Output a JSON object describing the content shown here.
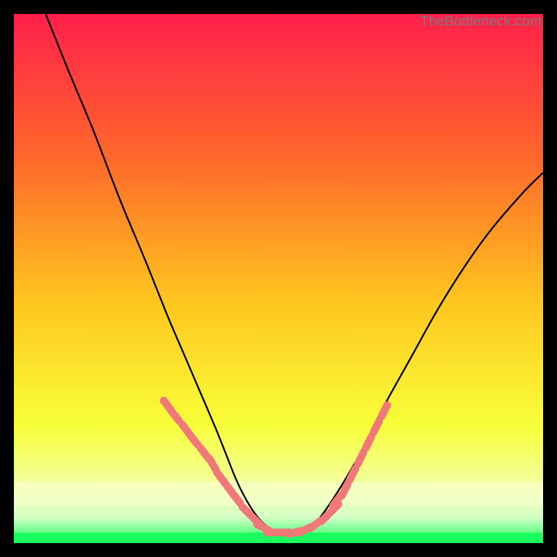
{
  "watermark": "TheBottleneck.com",
  "gradient": {
    "top": "#ff1f4b",
    "mid_upper": "#ff7a2a",
    "mid": "#ffd21f",
    "mid_lower": "#f6ff3a",
    "band": "#faffcf",
    "bottom": "#19ff5e"
  },
  "curve_color": "#000000",
  "marker_color": "#f07878",
  "chart_data": {
    "type": "line",
    "title": "",
    "xlabel": "",
    "ylabel": "",
    "xlim": [
      0,
      100
    ],
    "ylim": [
      0,
      100
    ],
    "series": [
      {
        "name": "curve",
        "x": [
          6,
          10,
          15,
          20,
          25,
          29,
          32,
          35,
          38,
          40,
          42,
          44,
          46,
          48,
          50,
          52,
          54,
          56,
          58,
          62,
          66,
          70,
          75,
          80,
          85,
          90,
          96,
          100
        ],
        "y": [
          100,
          90,
          78,
          65,
          53,
          43,
          36,
          29,
          22,
          17,
          12,
          8,
          5,
          3,
          2,
          2,
          2,
          3,
          5,
          11,
          18,
          26,
          35,
          44,
          52,
          59,
          66,
          70
        ]
      },
      {
        "name": "markers-left",
        "x": [
          29,
          30.5,
          32.5,
          34,
          36,
          37.5,
          39,
          40.5,
          42,
          44,
          46
        ],
        "y": [
          26,
          24,
          21.5,
          19.5,
          17,
          15,
          12.5,
          10.5,
          8.5,
          6,
          4
        ]
      },
      {
        "name": "markers-bottom",
        "x": [
          47,
          49,
          51,
          53,
          55,
          57,
          59,
          60.5
        ],
        "y": [
          3,
          2,
          2,
          2,
          2.5,
          3.5,
          5,
          6.5
        ]
      },
      {
        "name": "markers-right",
        "x": [
          61,
          62.5,
          64,
          65.5,
          67,
          68.5,
          70
        ],
        "y": [
          8,
          10,
          13,
          16,
          19,
          22,
          25
        ]
      }
    ]
  }
}
